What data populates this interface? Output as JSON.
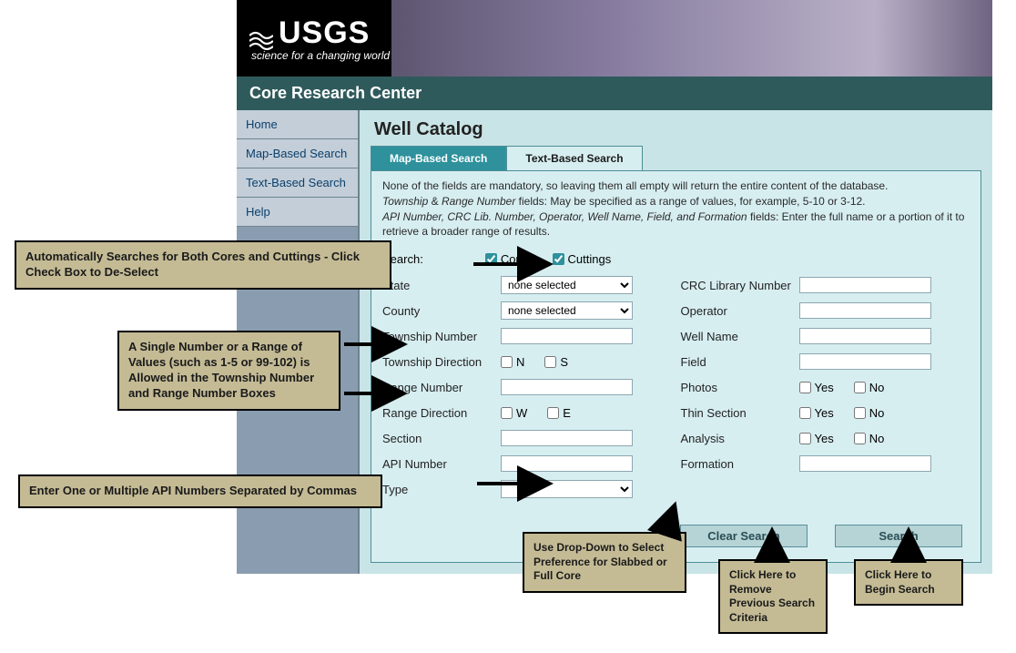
{
  "brand": {
    "name": "USGS",
    "tagline": "science for a changing world"
  },
  "site_title": "Core Research Center",
  "sidenav": {
    "items": [
      {
        "label": "Home"
      },
      {
        "label": "Map-Based Search"
      },
      {
        "label": "Text-Based Search"
      },
      {
        "label": "Help"
      }
    ]
  },
  "page_title": "Well Catalog",
  "tabs": {
    "inactive": "Map-Based Search",
    "active": "Text-Based Search"
  },
  "info_lines": {
    "l1": "None of the fields are mandatory, so leaving them all empty will return the entire content of the database.",
    "l2a": "Township",
    "l2amp": " & ",
    "l2b": "Range Number",
    "l2c": " fields: May be specified as a range of values, for example, 5-10 or 3-12.",
    "l3a": "API Number, CRC Lib. Number, Operator, Well Name, Field, and Formation",
    "l3b": " fields: Enter the full name or a portion of it to retrieve a broader range of results."
  },
  "search": {
    "label": "Search:",
    "cores": "Cores",
    "cuttings": "Cuttings"
  },
  "left_col": {
    "state": "State",
    "state_selected": "none selected",
    "county": "County",
    "county_selected": "none selected",
    "township_number": "Township Number",
    "township_direction": "Township Direction",
    "td_n": "N",
    "td_s": "S",
    "range_number": "Range Number",
    "range_direction": "Range Direction",
    "rd_w": "W",
    "rd_e": "E",
    "section": "Section",
    "api_number": "API Number",
    "type": "Type"
  },
  "right_col": {
    "crc_lib": "CRC Library Number",
    "operator": "Operator",
    "well_name": "Well Name",
    "field": "Field",
    "photos": "Photos",
    "thin_section": "Thin Section",
    "analysis": "Analysis",
    "formation": "Formation",
    "yes": "Yes",
    "no": "No"
  },
  "buttons": {
    "clear": "Clear Search",
    "search": "Search"
  },
  "callouts": {
    "c1": "Automatically  Searches for Both Cores and Cuttings - Click Check Box to De-Select",
    "c2": "A Single Number or a Range of Values (such as 1-5 or 99-102) is Allowed in the Township Number and Range Number Boxes",
    "c3": "Enter One or Multiple API Numbers Separated by Commas",
    "c4": "Use Drop-Down to Select Preference for Slabbed or Full Core",
    "c5": "Click Here to Remove Previous Search Criteria",
    "c6": "Click Here to Begin Search"
  }
}
